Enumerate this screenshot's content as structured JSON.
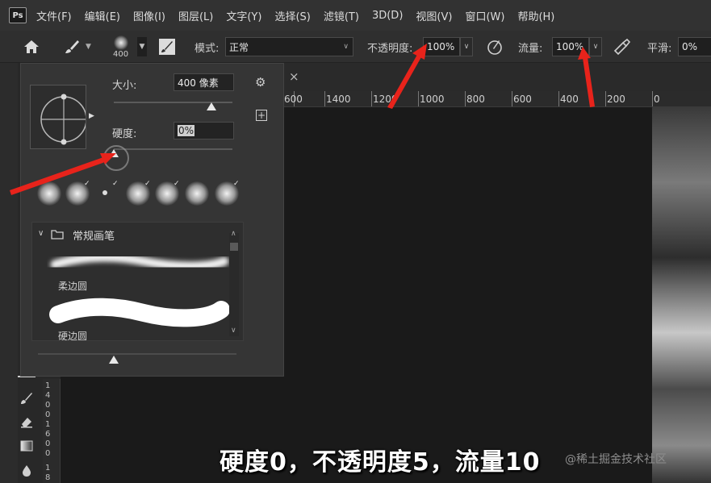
{
  "menubar": {
    "logo": "Ps",
    "items": [
      "文件(F)",
      "编辑(E)",
      "图像(I)",
      "图层(L)",
      "文字(Y)",
      "选择(S)",
      "滤镜(T)",
      "3D(D)",
      "视图(V)",
      "窗口(W)",
      "帮助(H)"
    ]
  },
  "options": {
    "brush_size_readout": "400",
    "mode_label": "模式:",
    "mode_value": "正常",
    "opacity_label": "不透明度:",
    "opacity_value": "100%",
    "flow_label": "流量:",
    "flow_value": "100%",
    "smoothing_label": "平滑:",
    "smoothing_value": "0%"
  },
  "brush_panel": {
    "size_label": "大小:",
    "size_value": "400 像素",
    "hardness_label": "硬度:",
    "hardness_value": "0%",
    "size_slider_level": 0.82,
    "hardness_slider_level": 0.0,
    "group_name": "常规画笔",
    "brushes": [
      "柔边圆",
      "硬边圆"
    ]
  },
  "ruler": {
    "horizontal_labels": [
      "600",
      "1400",
      "1200",
      "1000",
      "800",
      "600",
      "400",
      "200",
      "0"
    ],
    "vertical_labels_a": [
      "1",
      "4",
      "0",
      "0"
    ],
    "vertical_labels_b": [
      "1",
      "6",
      "0",
      "0"
    ],
    "vertical_labels_c": [
      "1",
      "8"
    ]
  },
  "tab": {
    "close_glyph": "×"
  },
  "caption": "硬度0，不透明度5，流量10",
  "watermark": "@稀土掘金技术社区",
  "colors": {
    "accent_arrow": "#e8231b",
    "panel_bg": "#353535",
    "canvas_bg": "#1a1a1a"
  },
  "icons": [
    "home-icon",
    "brush-icon",
    "brush-settings-icon",
    "airbrush-icon",
    "symmetry-icon",
    "gear-icon",
    "add-icon",
    "folder-icon",
    "chevron-down-icon"
  ]
}
